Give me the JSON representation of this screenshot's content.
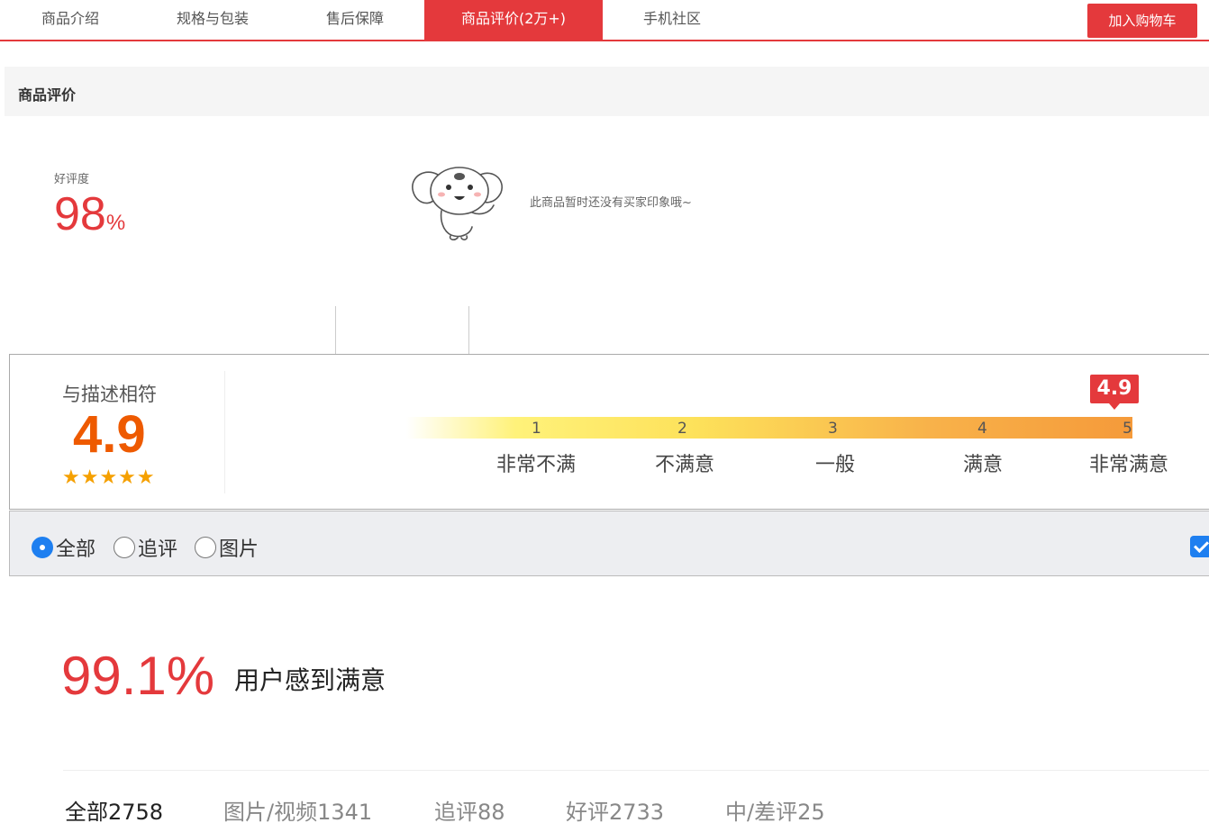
{
  "topbar": {
    "tabs": [
      {
        "label": "商品介绍"
      },
      {
        "label": "规格与包装"
      },
      {
        "label": "售后保障"
      },
      {
        "label": "商品评价(2万+)"
      },
      {
        "label": "手机社区"
      }
    ],
    "cart_button": "加入购物车",
    "accent_color": "#e4393c"
  },
  "section": {
    "title": "商品评价",
    "good_rate_label": "好评度",
    "good_rate_value": "98",
    "good_rate_unit": "%",
    "empty_message": "此商品暂时还没有买家印象哦~",
    "mascot_icon": "jd-dog-mascot-icon"
  },
  "rating": {
    "label": "与描述相符",
    "score": "4.9",
    "stars": "★★★★★",
    "marker_value": "4.9",
    "scale": [
      {
        "num": "1",
        "label": "非常不满"
      },
      {
        "num": "2",
        "label": "不满意"
      },
      {
        "num": "3",
        "label": "一般"
      },
      {
        "num": "4",
        "label": "满意"
      },
      {
        "num": "5",
        "label": "非常满意"
      }
    ]
  },
  "filters": {
    "options": [
      {
        "label": "全部",
        "checked": true
      },
      {
        "label": "追评",
        "checked": false
      },
      {
        "label": "图片",
        "checked": false
      }
    ],
    "checkbox_checked": true
  },
  "satisfaction": {
    "percent": "99.1%",
    "text": "用户感到满意"
  },
  "count_tabs": [
    {
      "label": "全部2758"
    },
    {
      "label": "图片/视频1341"
    },
    {
      "label": "追评88"
    },
    {
      "label": "好评2733"
    },
    {
      "label": "中/差评25"
    }
  ]
}
